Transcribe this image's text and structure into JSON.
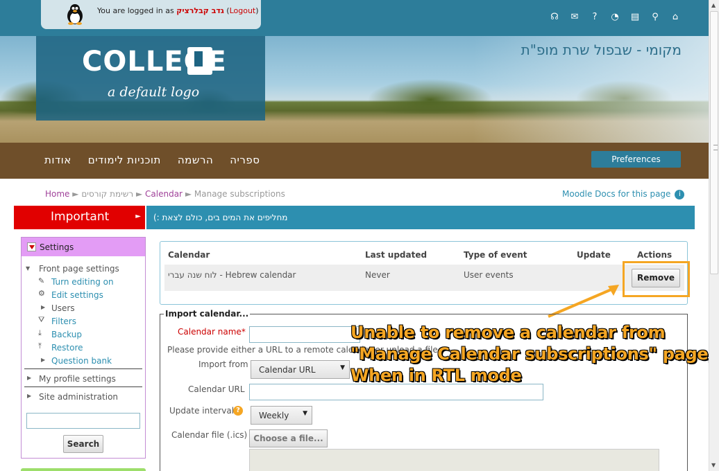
{
  "header": {
    "login_prefix": "You are logged in as",
    "user_name": "גדב קבלרציק",
    "logout_label": "Logout",
    "icons": [
      "headset-icon",
      "mail-icon",
      "help-icon",
      "rss-icon",
      "document-icon",
      "search-icon",
      "home-icon"
    ]
  },
  "banner": {
    "logo_text": "COLLEGE",
    "logo_subtitle": "a default logo",
    "site_title": "מקומי - שבפול שרת מופ\"ת"
  },
  "nav": {
    "items": [
      "אודות",
      "תוכניות לימודים",
      "הרשמה",
      "ספריה"
    ],
    "preferences_label": "Preferences"
  },
  "breadcrumb": {
    "home": "Home",
    "courses": "רשימת קורסים",
    "calendar": "Calendar",
    "current": "Manage subscriptions",
    "sep": "►"
  },
  "docs_link": "Moodle Docs for this page",
  "important": {
    "label": "Important",
    "ticker": "(: מחליפים את המים בים, כולם לצאת"
  },
  "settings_block": {
    "title": "Settings",
    "front_page": "Front page settings",
    "items": [
      "Turn editing on",
      "Edit settings",
      "Users",
      "Filters",
      "Backup",
      "Restore",
      "Question bank"
    ],
    "my_profile": "My profile settings",
    "site_admin": "Site administration",
    "search_button": "Search"
  },
  "calendar_table": {
    "headers": [
      "Calendar",
      "Last updated",
      "Type of event",
      "Update",
      "Actions"
    ],
    "row": {
      "calendar": "לוח שנה עברי - Hebrew calendar",
      "last_updated": "Never",
      "type": "User events",
      "update": "",
      "action": "Remove"
    }
  },
  "import_form": {
    "legend": "Import calendar...",
    "calendar_name_label": "Calendar name",
    "required_mark": "*",
    "hint": "Please provide either a URL to a remote calendar or upload a file.",
    "import_from_label": "Import from",
    "import_from_value": "Calendar URL",
    "calendar_url_label": "Calendar URL",
    "update_interval_label": "Update interval",
    "update_interval_value": "Weekly",
    "calendar_file_label": "Calendar file (.ics)",
    "choose_file_label": "Choose a file..."
  },
  "annotation": {
    "line1": "Unable to remove a calendar from",
    "line2": "\"Manage Calendar subscriptions\" page,",
    "line3": "When in RTL mode"
  },
  "colors": {
    "topbar": "#2d7d9a",
    "nav": "#6f4f2a",
    "important": "#e10000",
    "accent_orange": "#f5a623",
    "link": "#2d8fb0"
  }
}
